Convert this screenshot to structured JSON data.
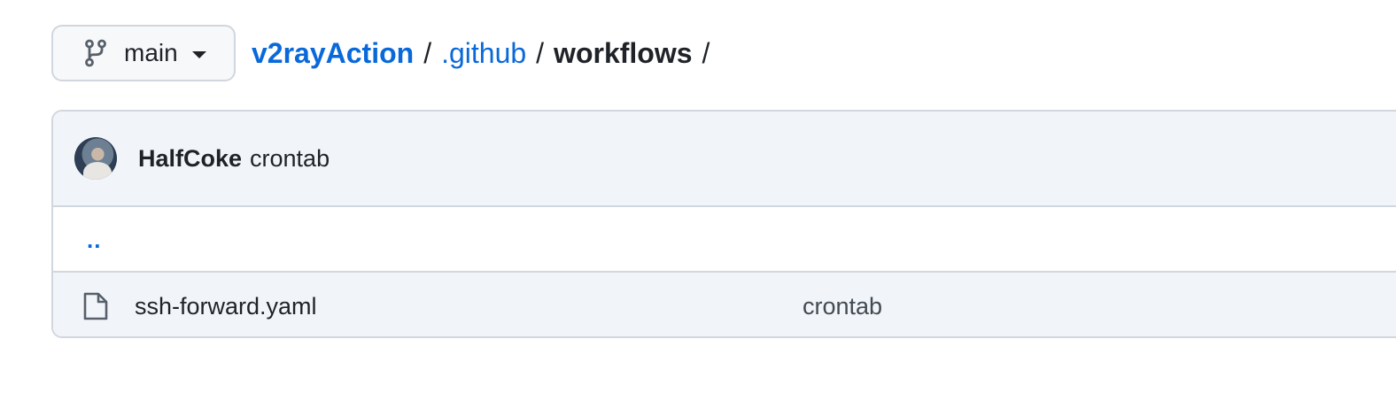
{
  "branch": {
    "icon": "git-branch-icon",
    "name": "main",
    "dropdown_icon": "caret-down-icon"
  },
  "breadcrumb": {
    "repo": "v2rayAction",
    "sep": "/",
    "folder": ".github",
    "current": "workflows",
    "trailing_sep": "/"
  },
  "latest_commit": {
    "avatar": "avatar-image",
    "author": "HalfCoke",
    "message": "crontab"
  },
  "parent_dir": {
    "label": ".."
  },
  "files": [
    {
      "icon": "file-icon",
      "name": "ssh-forward.yaml",
      "commit_message": "crontab"
    }
  ],
  "colors": {
    "link": "#0969da",
    "text": "#1f2328",
    "border": "#d0d7de",
    "header_bg": "#f1f5f9"
  }
}
